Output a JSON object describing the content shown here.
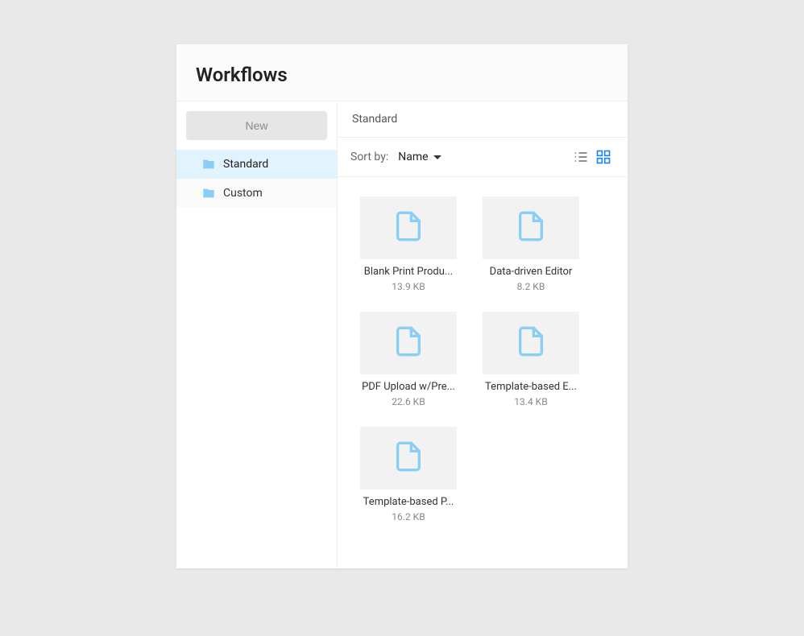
{
  "title": "Workflows",
  "sidebar": {
    "new_button": "New",
    "folders": [
      {
        "label": "Standard",
        "active": true
      },
      {
        "label": "Custom",
        "active": false
      }
    ]
  },
  "breadcrumb": "Standard",
  "toolbar": {
    "sort_label": "Sort by:",
    "sort_value": "Name",
    "view_mode": "grid"
  },
  "files": [
    {
      "name": "Blank Print Produ...",
      "size": "13.9 KB"
    },
    {
      "name": "Data-driven Editor",
      "size": "8.2 KB"
    },
    {
      "name": "PDF Upload w/Pre...",
      "size": "22.6 KB"
    },
    {
      "name": "Template-based E...",
      "size": "13.4 KB"
    },
    {
      "name": "Template-based P...",
      "size": "16.2 KB"
    }
  ]
}
